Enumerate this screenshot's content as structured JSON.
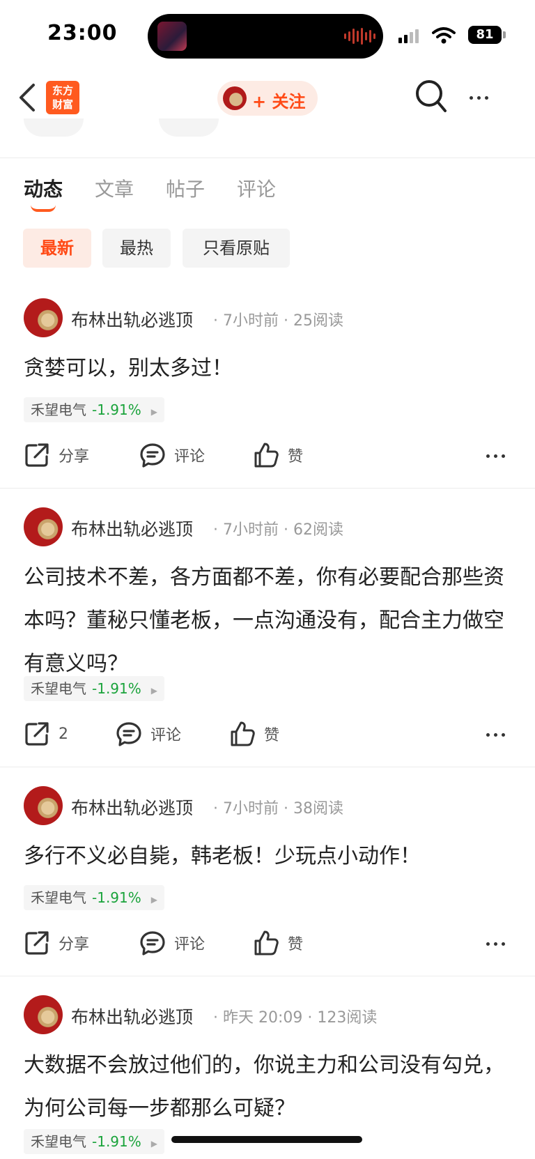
{
  "status_bar": {
    "time": "23:00",
    "battery": "81"
  },
  "nav": {
    "logo_text": "东方\n财富",
    "follow_label": "+ 关注"
  },
  "tabs": [
    {
      "label": "动态",
      "active": true
    },
    {
      "label": "文章",
      "active": false
    },
    {
      "label": "帖子",
      "active": false
    },
    {
      "label": "评论",
      "active": false
    }
  ],
  "filters": [
    {
      "label": "最新",
      "active": true
    },
    {
      "label": "最热",
      "active": false
    },
    {
      "label": "只看原贴",
      "active": false
    }
  ],
  "posts": [
    {
      "author": "布林出轨必逃顶",
      "time": "7小时前",
      "reads": "25阅读",
      "content": "贪婪可以，别太多过！",
      "stock_name": "禾望电气",
      "stock_change": "-1.91%",
      "share_label": "分享",
      "comment_label": "评论",
      "like_label": "赞"
    },
    {
      "author": "布林出轨必逃顶",
      "time": "7小时前",
      "reads": "62阅读",
      "content": "公司技术不差，各方面都不差，你有必要配合那些资本吗？董秘只懂老板，一点沟通没有，配合主力做空有意义吗？",
      "stock_name": "禾望电气",
      "stock_change": "-1.91%",
      "share_label": "2",
      "comment_label": "评论",
      "like_label": "赞"
    },
    {
      "author": "布林出轨必逃顶",
      "time": "7小时前",
      "reads": "38阅读",
      "content": "多行不义必自毙，韩老板！少玩点小动作！",
      "stock_name": "禾望电气",
      "stock_change": "-1.91%",
      "share_label": "分享",
      "comment_label": "评论",
      "like_label": "赞"
    },
    {
      "author": "布林出轨必逃顶",
      "time": "昨天 20:09",
      "reads": "123阅读",
      "content": "大数据不会放过他们的，你说主力和公司没有勾兑，为何公司每一步都那么可疑？",
      "stock_name": "禾望电气",
      "stock_change": "-1.91%"
    }
  ],
  "icons": {
    "back": "chevron-left-icon",
    "search": "search-icon",
    "more": "more-horizontal-icon",
    "share": "share-icon",
    "comment": "comment-icon",
    "like": "thumbs-up-icon"
  },
  "colors": {
    "accent": "#ff5a1f",
    "stock_down": "#1aa33b"
  }
}
